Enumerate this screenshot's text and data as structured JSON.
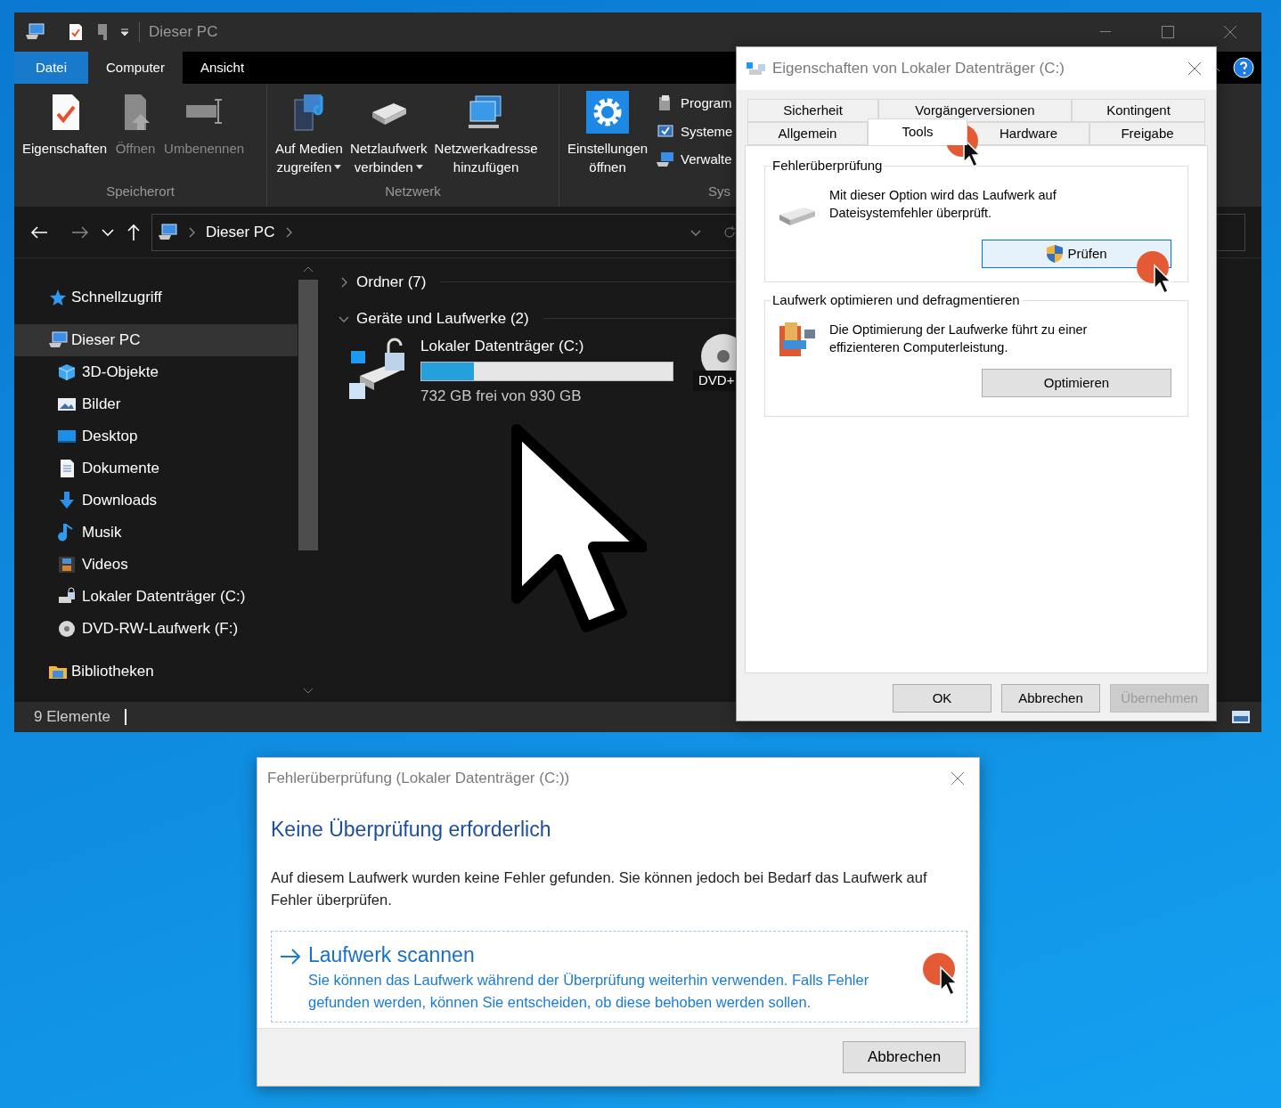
{
  "explorer": {
    "title": "Dieser PC",
    "ribbon_tabs": [
      {
        "label": "Datei",
        "kind": "file"
      },
      {
        "label": "Computer",
        "kind": "tab",
        "selected": true
      },
      {
        "label": "Ansicht",
        "kind": "tab",
        "selected": false
      }
    ],
    "ribbon_groups": [
      {
        "label": "Speicherort",
        "commands": [
          {
            "lines": [
              "Eigenschaften"
            ],
            "disabled": false,
            "dropdown": false
          },
          {
            "lines": [
              "Öffnen"
            ],
            "disabled": true,
            "dropdown": false
          },
          {
            "lines": [
              "Umbenennen"
            ],
            "disabled": true,
            "dropdown": false
          }
        ]
      },
      {
        "label": "Netzwerk",
        "commands": [
          {
            "lines": [
              "Auf Medien",
              "zugreifen"
            ],
            "disabled": false,
            "dropdown": true
          },
          {
            "lines": [
              "Netzlaufwerk",
              "verbinden"
            ],
            "disabled": false,
            "dropdown": true
          },
          {
            "lines": [
              "Netzwerkadresse",
              "hinzufügen"
            ],
            "disabled": false,
            "dropdown": false
          }
        ]
      },
      {
        "label": "Sys",
        "commands": [
          {
            "lines": [
              "Einstellungen",
              "öffnen"
            ],
            "disabled": false,
            "dropdown": false
          }
        ],
        "small_commands": [
          "Program",
          "Systeme",
          "Verwalte"
        ]
      }
    ],
    "address": {
      "path": "Dieser PC"
    },
    "nav": [
      {
        "label": "Schnellzugriff",
        "selected": false
      },
      {
        "label": "Dieser PC",
        "selected": true,
        "children": [
          {
            "label": "3D-Objekte",
            "selected": false
          },
          {
            "label": "Bilder",
            "selected": false
          },
          {
            "label": "Desktop",
            "selected": false
          },
          {
            "label": "Dokumente",
            "selected": false
          },
          {
            "label": "Downloads",
            "selected": false
          },
          {
            "label": "Musik",
            "selected": false
          },
          {
            "label": "Videos",
            "selected": false
          },
          {
            "label": "Lokaler Datenträger (C:)",
            "selected": false
          },
          {
            "label": "DVD-RW-Laufwerk (F:)",
            "selected": false
          }
        ]
      },
      {
        "label": "Bibliotheken",
        "selected": false
      }
    ],
    "sections": [
      {
        "label": "Ordner (7)",
        "expanded": false
      },
      {
        "label": "Geräte und Laufwerke (2)",
        "expanded": true
      }
    ],
    "drive": {
      "name": "Lokaler Datenträger (C:)",
      "level": 0.21,
      "reading": "732 GB frei von 930 GB"
    },
    "dvd_label": "DVD+",
    "status": "9 Elemente"
  },
  "properties": {
    "title": "Eigenschaften von Lokaler Datenträger (C:)",
    "tab_rows": [
      [
        {
          "label": "Sicherheit",
          "selected": false
        },
        {
          "label": "Vorgängerversionen",
          "selected": false
        },
        {
          "label": "Kontingent",
          "selected": false
        }
      ],
      [
        {
          "label": "Allgemein",
          "selected": false
        },
        {
          "label": "Tools",
          "selected": true
        },
        {
          "label": "Hardware",
          "selected": false
        },
        {
          "label": "Freigabe",
          "selected": false
        }
      ]
    ],
    "groups": [
      {
        "title": "Fehlerüberprüfung",
        "text": "Mit dieser Option wird das Laufwerk auf Dateisystemfehler überprüft.",
        "button": "Prüfen",
        "shield": true,
        "focused": true
      },
      {
        "title": "Laufwerk optimieren und defragmentieren",
        "text": "Die Optimierung der Laufwerke führt zu einer effizienteren Computerleistung.",
        "button": "Optimieren",
        "shield": false,
        "focused": false
      }
    ],
    "buttons": [
      {
        "label": "OK",
        "disabled": false
      },
      {
        "label": "Abbrechen",
        "disabled": false
      },
      {
        "label": "Übernehmen",
        "disabled": true
      }
    ]
  },
  "check_dialog": {
    "title": "Fehlerüberprüfung (Lokaler Datenträger (C:))",
    "heading": "Keine Überprüfung erforderlich",
    "text": "Auf diesem Laufwerk wurden keine Fehler gefunden. Sie können jedoch bei Bedarf das Laufwerk auf Fehler überprüfen.",
    "option": {
      "title": "Laufwerk scannen",
      "text": "Sie können das Laufwerk während der Überprüfung weiterhin verwenden. Falls Fehler gefunden werden, können Sie entscheiden, ob diese behoben werden sollen."
    },
    "button": "Abbrechen"
  }
}
